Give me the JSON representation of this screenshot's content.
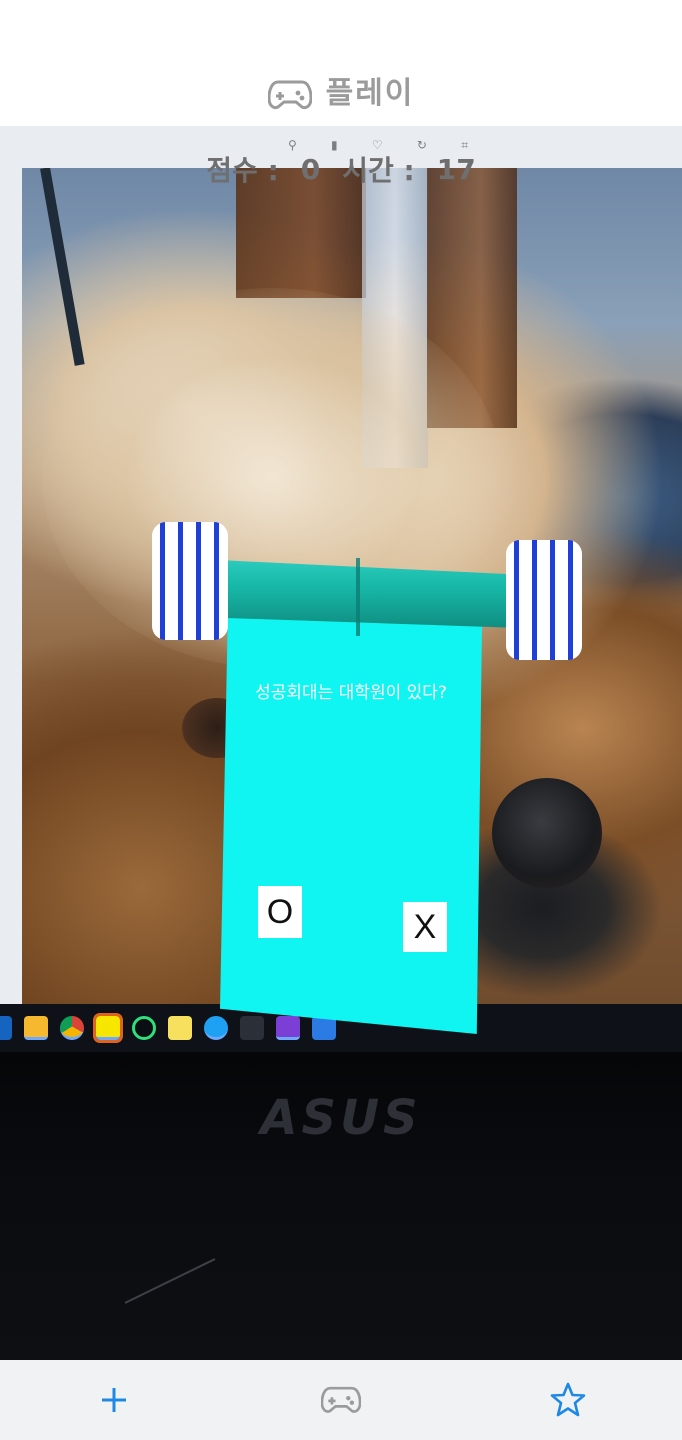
{
  "header": {
    "title": "플레이",
    "icon": "gamepad-icon"
  },
  "status": {
    "score_label": "점수 :",
    "score_value": "0",
    "time_label": "시간 :",
    "time_value": "17"
  },
  "quiz": {
    "question": "성공회대는 대학원이 있다?",
    "answer_o": "O",
    "answer_x": "X"
  },
  "laptop": {
    "brand": "ASUS"
  },
  "bottom_nav": {
    "items": [
      {
        "name": "add",
        "icon": "plus-icon"
      },
      {
        "name": "play",
        "icon": "gamepad-icon"
      },
      {
        "name": "favorites",
        "icon": "star-icon"
      }
    ]
  },
  "colors": {
    "accent_blue": "#1e88e5",
    "sheet_cyan": "#10f5f2",
    "header_gray": "#9b9b9b"
  }
}
